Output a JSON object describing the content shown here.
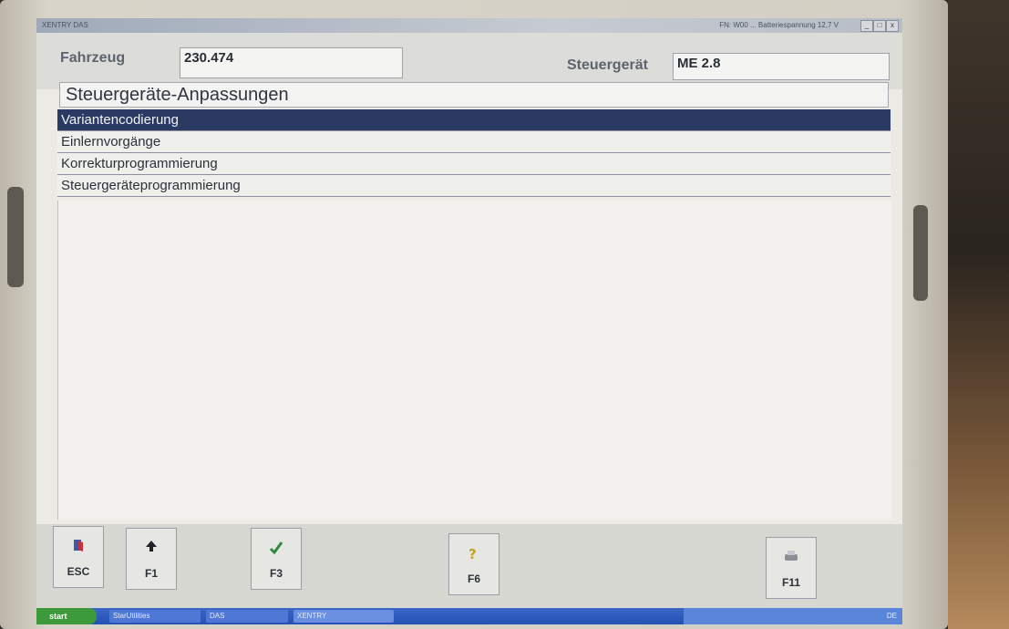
{
  "window": {
    "title": "XENTRY DAS",
    "right_info": "FN: W00 ...  Batteriespannung 12,7 V",
    "minimize": "_",
    "maximize": "□",
    "close": "x"
  },
  "header": {
    "vehicle_label": "Fahrzeug",
    "vehicle_value": "230.474",
    "ecu_label": "Steuergerät",
    "ecu_value": "ME 2.8"
  },
  "page": {
    "heading": "Steuergeräte-Anpassungen"
  },
  "menu": {
    "items": [
      {
        "label": "Variantencodierung",
        "selected": true
      },
      {
        "label": "Einlernvorgänge",
        "selected": false
      },
      {
        "label": "Korrekturprogrammierung",
        "selected": false
      },
      {
        "label": "Steuergeräteprogrammierung",
        "selected": false
      }
    ]
  },
  "function_keys": [
    {
      "key": "ESC",
      "icon": "exit-door-icon"
    },
    {
      "key": "F1",
      "icon": "arrow-up-icon"
    },
    {
      "key": "F3",
      "icon": "checkmark-icon"
    },
    {
      "key": "F6",
      "icon": "help-icon"
    },
    {
      "key": "F11",
      "icon": "printer-icon"
    }
  ],
  "taskbar": {
    "start": "start",
    "tasks": [
      "StarUtilities",
      "DAS",
      "XENTRY"
    ],
    "tray": "DE"
  },
  "colors": {
    "selection": "#2a3a63",
    "taskbar": "#2551b5"
  }
}
